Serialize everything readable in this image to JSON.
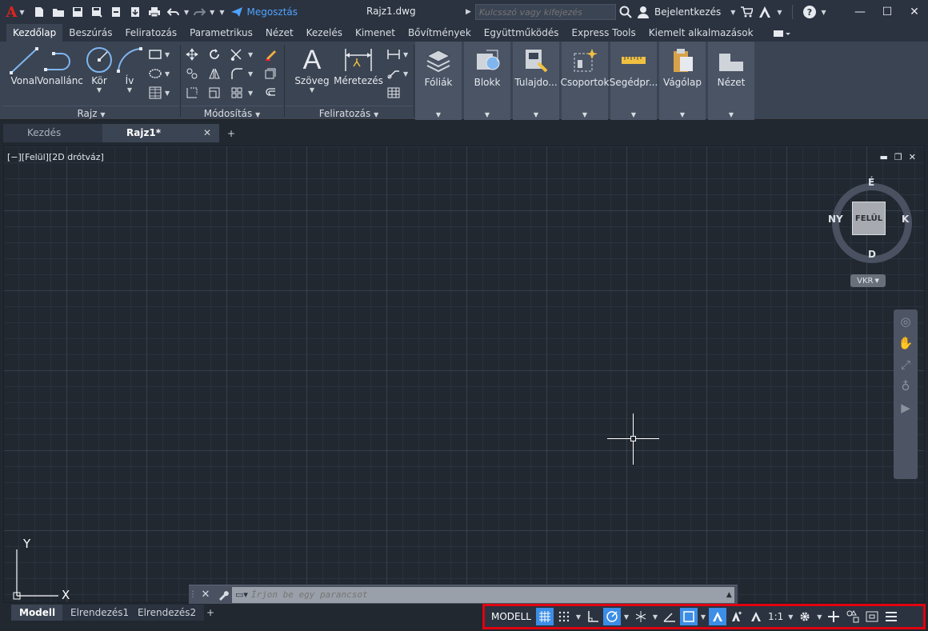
{
  "app": {
    "logo": "A",
    "share_label": "Megosztás",
    "document_title": "Rajz1.dwg",
    "search_placeholder": "Kulcsszó vagy kifejezés",
    "login_label": "Bejelentkezés"
  },
  "ribbon": {
    "tabs": [
      "Kezdőlap",
      "Beszúrás",
      "Feliratozás",
      "Parametrikus",
      "Nézet",
      "Kezelés",
      "Kimenet",
      "Bővítmények",
      "Együttműködés",
      "Express Tools",
      "Kiemelt alkalmazások"
    ],
    "active_tab": "Kezdőlap",
    "draw": {
      "title": "Rajz",
      "line": "Vonal",
      "polyline": "Vonallánc",
      "circle": "Kör",
      "arc": "Ív"
    },
    "modify": {
      "title": "Módosítás"
    },
    "annotation": {
      "title": "Feliratozás",
      "text": "Szöveg",
      "dimension": "Méretezés"
    },
    "tiles": {
      "layers": "Fóliák",
      "block": "Blokk",
      "properties": "Tulajdo...",
      "groups": "Csoportok",
      "utilities": "Segédpr...",
      "clipboard": "Vágólap",
      "view": "Nézet"
    }
  },
  "doc_tabs": {
    "start": "Kezdés",
    "drawing": "Rajz1*"
  },
  "viewport": {
    "label": "[−][Felül][2D drótváz]",
    "viewcube": {
      "face": "FELÜL",
      "north": "É",
      "south": "D",
      "east": "K",
      "west": "NY"
    },
    "wcs": "VKR",
    "ucs_x": "X",
    "ucs_y": "Y"
  },
  "command": {
    "placeholder": "Írjon be egy parancsot"
  },
  "layout_tabs": [
    "Modell",
    "Elrendezés1",
    "Elrendezés2"
  ],
  "status": {
    "model": "MODELL",
    "scale": "1:1",
    "highlight_color": "#e10010",
    "active_color": "#3c8ee6"
  }
}
